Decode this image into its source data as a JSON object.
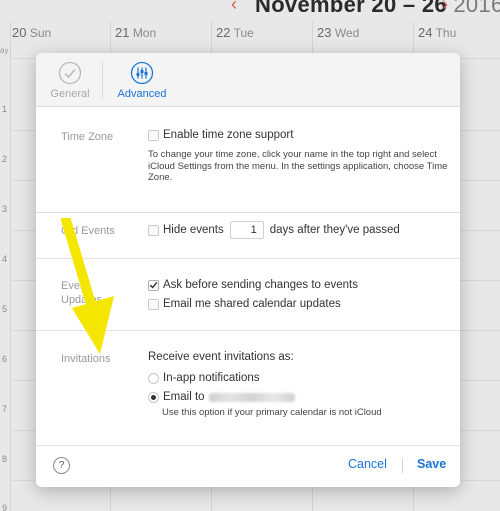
{
  "calendar": {
    "title": "November 20 – 26",
    "year": "2016",
    "prev_icon": "chevron-left-icon",
    "next_icon": "chevron-right-icon",
    "days": [
      {
        "num": "20",
        "name": "Sun"
      },
      {
        "num": "21",
        "name": "Mon"
      },
      {
        "num": "22",
        "name": "Tue"
      },
      {
        "num": "23",
        "name": "Wed"
      },
      {
        "num": "24",
        "name": "Thu"
      }
    ],
    "allday_label": "ay",
    "hours": [
      "1",
      "2",
      "3",
      "4",
      "5",
      "6",
      "7",
      "8",
      "9"
    ]
  },
  "settings": {
    "tabs": [
      {
        "label": "General",
        "icon": "checkmark-circle-icon",
        "active": false
      },
      {
        "label": "Advanced",
        "icon": "sliders-icon",
        "active": true
      }
    ],
    "time_zone": {
      "label": "Time Zone",
      "checkbox_label": "Enable time zone support",
      "checked": false,
      "help": "To change your time zone, click your name in the top right and select iCloud Settings from the menu. In the settings application, choose Time Zone."
    },
    "old_events": {
      "label": "Old Events",
      "checkbox_label": "Hide events",
      "checked": false,
      "days_value": "1",
      "suffix": "days after they've passed"
    },
    "event_updates": {
      "label_line1": "Event",
      "label_line2": "Updates",
      "ask_label": "Ask before sending changes to events",
      "ask_checked": true,
      "email_label": "Email me shared calendar updates",
      "email_checked": false
    },
    "invitations": {
      "label": "Invitations",
      "heading": "Receive event invitations as:",
      "option_inapp": "In-app notifications",
      "option_email": "Email to",
      "selected": "email",
      "note": "Use this option if your primary calendar is not iCloud"
    },
    "footer": {
      "help_label": "?",
      "cancel_label": "Cancel",
      "save_label": "Save"
    }
  },
  "colors": {
    "accent": "#1a73d9",
    "arrow": "#f5e600",
    "nav": "#d65a4a"
  }
}
